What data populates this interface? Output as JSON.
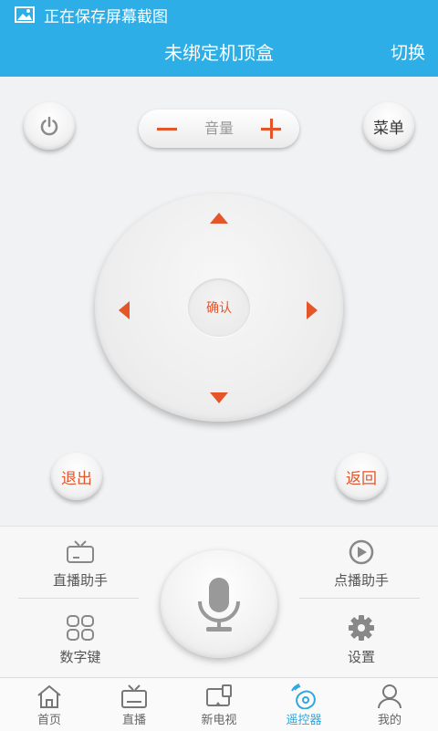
{
  "status_bar": {
    "notification_text": "正在保存屏幕截图",
    "icon": "image-icon"
  },
  "header": {
    "title": "未绑定机顶盒",
    "switch_label": "切换"
  },
  "remote": {
    "power_icon": "power-icon",
    "volume_label": "音量",
    "menu_label": "菜单",
    "ok_label": "确认",
    "exit_label": "退出",
    "back_label": "返回"
  },
  "tools": {
    "live_helper": "直播助手",
    "vod_helper": "点播助手",
    "numeric_keys": "数字键",
    "settings": "设置"
  },
  "tabs": [
    {
      "label": "首页",
      "icon": "home-icon"
    },
    {
      "label": "直播",
      "icon": "tv-icon"
    },
    {
      "label": "新电视",
      "icon": "new-tv-icon"
    },
    {
      "label": "遥控器",
      "icon": "remote-icon",
      "active": true
    },
    {
      "label": "我的",
      "icon": "user-icon"
    }
  ],
  "colors": {
    "primary": "#2eaee6",
    "accent": "#e5552a",
    "active_tab": "#2ea7e0"
  }
}
